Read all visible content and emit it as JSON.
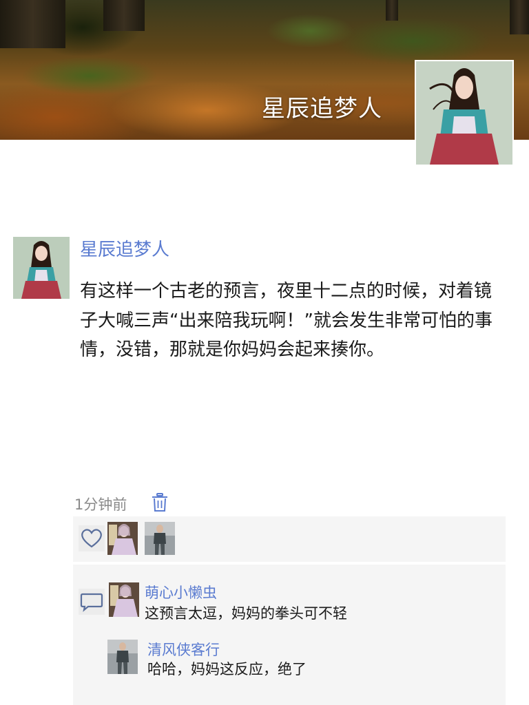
{
  "cover": {
    "title": "星辰追梦人"
  },
  "post": {
    "author": "星辰追梦人",
    "text": "有这样一个古老的预言，夜里十二点的时候，对着镜子大喊三声“出来陪我玩啊！”就会发生非常可怕的事情，没错，那就是你妈妈会起来揍你。",
    "time": "1分钟前"
  },
  "comments": [
    {
      "author": "萌心小懒虫",
      "text": "这预言太逗，妈妈的拳头可不轻"
    },
    {
      "author": "清风侠客行",
      "text": "哈哈，妈妈这反应，绝了"
    }
  ],
  "colors": {
    "link": "#5a7bd0",
    "panel": "#f5f5f5",
    "muted": "#8a8a8a"
  },
  "icons": {
    "delete": "trash-icon",
    "like": "heart-icon",
    "comment": "comment-icon"
  }
}
